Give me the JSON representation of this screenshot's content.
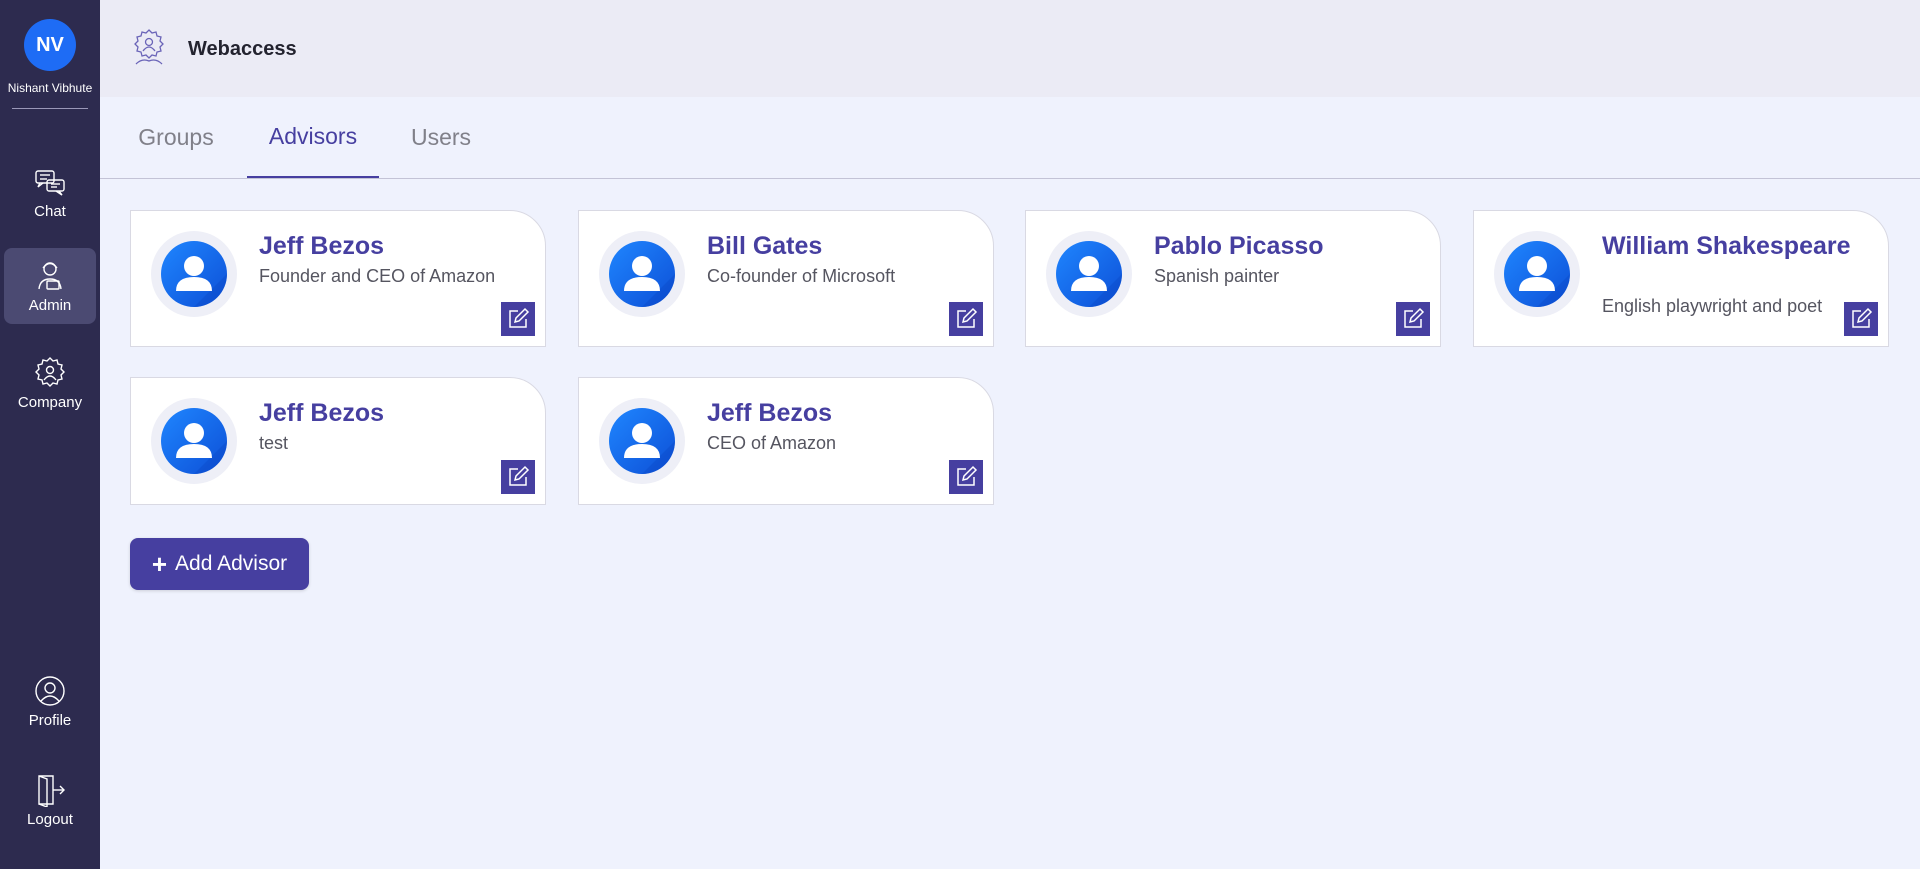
{
  "user": {
    "initials": "NV",
    "name": "Nishant Vibhute"
  },
  "nav": {
    "chat": "Chat",
    "admin": "Admin",
    "company": "Company",
    "profile": "Profile",
    "logout": "Logout"
  },
  "header": {
    "title": "Webaccess"
  },
  "tabs": [
    {
      "label": "Groups",
      "active": false
    },
    {
      "label": "Advisors",
      "active": true
    },
    {
      "label": "Users",
      "active": false
    }
  ],
  "advisors": [
    {
      "name": "Jeff Bezos",
      "title": "Founder and CEO of Amazon"
    },
    {
      "name": "Bill Gates",
      "title": "Co-founder of Microsoft"
    },
    {
      "name": "Pablo Picasso",
      "title": "Spanish painter"
    },
    {
      "name": "William Shakespeare",
      "title": "English playwright and poet"
    },
    {
      "name": "Jeff Bezos",
      "title": "test"
    },
    {
      "name": "Jeff Bezos",
      "title": "CEO of Amazon"
    }
  ],
  "actions": {
    "add_advisor": "Add Advisor"
  },
  "colors": {
    "accent": "#463fa0",
    "sidebar": "#2d2b4f",
    "avatar_blue": "#1e6cf5",
    "background": "#eff2fd"
  },
  "icons": {
    "chat": "chat-bubbles-icon",
    "admin": "admin-person-icon",
    "company": "company-badge-icon",
    "profile": "profile-icon",
    "logout": "logout-door-icon",
    "edit": "edit-pencil-icon",
    "add": "plus-icon"
  }
}
